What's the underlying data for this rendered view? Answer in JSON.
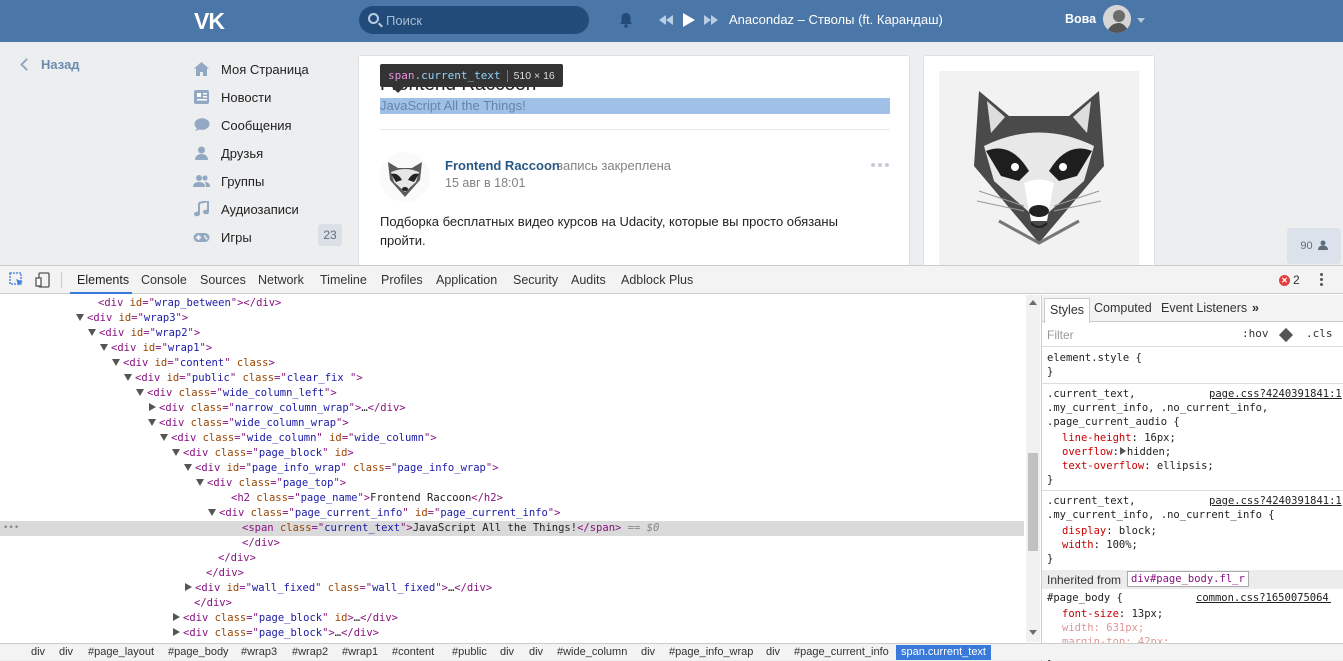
{
  "header": {
    "logo": "VK",
    "search_placeholder": "Поиск",
    "now_playing": "Anacondaz – Стволы (ft. Карандаш)",
    "user_name": "Вова"
  },
  "left_nav": {
    "back_label": "Назад",
    "items": [
      {
        "label": "Моя Страница",
        "icon": "home-icon"
      },
      {
        "label": "Новости",
        "icon": "news-icon"
      },
      {
        "label": "Сообщения",
        "icon": "messages-icon"
      },
      {
        "label": "Друзья",
        "icon": "friends-icon"
      },
      {
        "label": "Группы",
        "icon": "groups-icon"
      },
      {
        "label": "Аудиозаписи",
        "icon": "music-icon"
      },
      {
        "label": "Игры",
        "icon": "games-icon",
        "count": "23"
      }
    ]
  },
  "page": {
    "name": "Frontend Raccoon",
    "current_text": "JavaScript All the Things!",
    "tooltip": {
      "tag": "span",
      "cls": ".current_text",
      "size": "510 × 16"
    }
  },
  "post": {
    "author": "Frontend Raccoon",
    "pinned_note": "запись закреплена",
    "date": "15 авг в 18:01",
    "text": "Подборка бесплатных видео курсов на Udacity, которые вы просто обязаны пройти."
  },
  "online_count": "90",
  "devtools": {
    "tabs": [
      "Elements",
      "Console",
      "Sources",
      "Network",
      "Timeline",
      "Profiles",
      "Application",
      "Security",
      "Audits",
      "Adblock Plus"
    ],
    "active_tab": "Elements",
    "error_count": "2",
    "dom_lines": [
      [
        {
          "t": "tag",
          "v": "<div "
        },
        {
          "t": "attr",
          "v": "id"
        },
        {
          "t": "tag",
          "v": "=\""
        },
        {
          "t": "val",
          "v": "wrap_between"
        },
        {
          "t": "tag",
          "v": "\"></div>"
        }
      ],
      [
        {
          "t": "tag",
          "v": "<div "
        },
        {
          "t": "attr",
          "v": "id"
        },
        {
          "t": "tag",
          "v": "=\""
        },
        {
          "t": "val",
          "v": "wrap3"
        },
        {
          "t": "tag",
          "v": "\">"
        }
      ],
      [
        {
          "t": "tag",
          "v": "<div "
        },
        {
          "t": "attr",
          "v": "id"
        },
        {
          "t": "tag",
          "v": "=\""
        },
        {
          "t": "val",
          "v": "wrap2"
        },
        {
          "t": "tag",
          "v": "\">"
        }
      ],
      [
        {
          "t": "tag",
          "v": "<div "
        },
        {
          "t": "attr",
          "v": "id"
        },
        {
          "t": "tag",
          "v": "=\""
        },
        {
          "t": "val",
          "v": "wrap1"
        },
        {
          "t": "tag",
          "v": "\">"
        }
      ],
      [
        {
          "t": "tag",
          "v": "<div "
        },
        {
          "t": "attr",
          "v": "id"
        },
        {
          "t": "tag",
          "v": "=\""
        },
        {
          "t": "val",
          "v": "content"
        },
        {
          "t": "tag",
          "v": "\" "
        },
        {
          "t": "attr",
          "v": "class"
        },
        {
          "t": "tag",
          "v": ">"
        }
      ],
      [
        {
          "t": "tag",
          "v": "<div "
        },
        {
          "t": "attr",
          "v": "id"
        },
        {
          "t": "tag",
          "v": "=\""
        },
        {
          "t": "val",
          "v": "public"
        },
        {
          "t": "tag",
          "v": "\" "
        },
        {
          "t": "attr",
          "v": "class"
        },
        {
          "t": "tag",
          "v": "=\""
        },
        {
          "t": "val",
          "v": "clear_fix "
        },
        {
          "t": "tag",
          "v": "\">"
        }
      ],
      [
        {
          "t": "tag",
          "v": "<div "
        },
        {
          "t": "attr",
          "v": "class"
        },
        {
          "t": "tag",
          "v": "=\""
        },
        {
          "t": "val",
          "v": "wide_column_left"
        },
        {
          "t": "tag",
          "v": "\">"
        }
      ],
      [
        {
          "t": "tag",
          "v": "<div "
        },
        {
          "t": "attr",
          "v": "class"
        },
        {
          "t": "tag",
          "v": "=\""
        },
        {
          "t": "val",
          "v": "narrow_column_wrap"
        },
        {
          "t": "tag",
          "v": "\">"
        },
        {
          "t": "txt",
          "v": "…"
        },
        {
          "t": "tag",
          "v": "</div>"
        }
      ],
      [
        {
          "t": "tag",
          "v": "<div "
        },
        {
          "t": "attr",
          "v": "class"
        },
        {
          "t": "tag",
          "v": "=\""
        },
        {
          "t": "val",
          "v": "wide_column_wrap"
        },
        {
          "t": "tag",
          "v": "\">"
        }
      ],
      [
        {
          "t": "tag",
          "v": "<div "
        },
        {
          "t": "attr",
          "v": "class"
        },
        {
          "t": "tag",
          "v": "=\""
        },
        {
          "t": "val",
          "v": "wide_column"
        },
        {
          "t": "tag",
          "v": "\" "
        },
        {
          "t": "attr",
          "v": "id"
        },
        {
          "t": "tag",
          "v": "=\""
        },
        {
          "t": "val",
          "v": "wide_column"
        },
        {
          "t": "tag",
          "v": "\">"
        }
      ],
      [
        {
          "t": "tag",
          "v": "<div "
        },
        {
          "t": "attr",
          "v": "class"
        },
        {
          "t": "tag",
          "v": "=\""
        },
        {
          "t": "val",
          "v": "page_block"
        },
        {
          "t": "tag",
          "v": "\" "
        },
        {
          "t": "attr",
          "v": "id"
        },
        {
          "t": "tag",
          "v": ">"
        }
      ],
      [
        {
          "t": "tag",
          "v": "<div "
        },
        {
          "t": "attr",
          "v": "id"
        },
        {
          "t": "tag",
          "v": "=\""
        },
        {
          "t": "val",
          "v": "page_info_wrap"
        },
        {
          "t": "tag",
          "v": "\" "
        },
        {
          "t": "attr",
          "v": "class"
        },
        {
          "t": "tag",
          "v": "=\""
        },
        {
          "t": "val",
          "v": "page_info_wrap"
        },
        {
          "t": "tag",
          "v": "\">"
        }
      ],
      [
        {
          "t": "tag",
          "v": "<div "
        },
        {
          "t": "attr",
          "v": "class"
        },
        {
          "t": "tag",
          "v": "=\""
        },
        {
          "t": "val",
          "v": "page_top"
        },
        {
          "t": "tag",
          "v": "\">"
        }
      ],
      [
        {
          "t": "tag",
          "v": "<h2 "
        },
        {
          "t": "attr",
          "v": "class"
        },
        {
          "t": "tag",
          "v": "=\""
        },
        {
          "t": "val",
          "v": "page_name"
        },
        {
          "t": "tag",
          "v": "\">"
        },
        {
          "t": "txt",
          "v": "Frontend Raccoon"
        },
        {
          "t": "tag",
          "v": "</h2>"
        }
      ],
      [
        {
          "t": "tag",
          "v": "<div "
        },
        {
          "t": "attr",
          "v": "class"
        },
        {
          "t": "tag",
          "v": "=\""
        },
        {
          "t": "val",
          "v": "page_current_info"
        },
        {
          "t": "tag",
          "v": "\" "
        },
        {
          "t": "attr",
          "v": "id"
        },
        {
          "t": "tag",
          "v": "=\""
        },
        {
          "t": "val",
          "v": "page_current_info"
        },
        {
          "t": "tag",
          "v": "\">"
        }
      ],
      [
        {
          "t": "tag",
          "v": "<span "
        },
        {
          "t": "attr",
          "v": "class"
        },
        {
          "t": "tag",
          "v": "=\""
        },
        {
          "t": "val",
          "v": "current_text"
        },
        {
          "t": "tag",
          "v": "\">"
        },
        {
          "t": "txt",
          "v": "JavaScript All the Things!"
        },
        {
          "t": "tag",
          "v": "</span>"
        },
        {
          "t": "eq",
          "v": " == $0"
        }
      ],
      [
        {
          "t": "tag",
          "v": "</div>"
        }
      ],
      [
        {
          "t": "tag",
          "v": "</div>"
        }
      ],
      [
        {
          "t": "tag",
          "v": "</div>"
        }
      ],
      [
        {
          "t": "tag",
          "v": "<div "
        },
        {
          "t": "attr",
          "v": "id"
        },
        {
          "t": "tag",
          "v": "=\""
        },
        {
          "t": "val",
          "v": "wall_fixed"
        },
        {
          "t": "tag",
          "v": "\" "
        },
        {
          "t": "attr",
          "v": "class"
        },
        {
          "t": "tag",
          "v": "=\""
        },
        {
          "t": "val",
          "v": "wall_fixed"
        },
        {
          "t": "tag",
          "v": "\">"
        },
        {
          "t": "txt",
          "v": "…"
        },
        {
          "t": "tag",
          "v": "</div>"
        }
      ],
      [
        {
          "t": "tag",
          "v": "</div>"
        }
      ],
      [
        {
          "t": "tag",
          "v": "<div "
        },
        {
          "t": "attr",
          "v": "class"
        },
        {
          "t": "tag",
          "v": "=\""
        },
        {
          "t": "val",
          "v": "page_block"
        },
        {
          "t": "tag",
          "v": "\" "
        },
        {
          "t": "attr",
          "v": "id"
        },
        {
          "t": "tag",
          "v": ">"
        },
        {
          "t": "txt",
          "v": "…"
        },
        {
          "t": "tag",
          "v": "</div>"
        }
      ],
      [
        {
          "t": "tag",
          "v": "<div "
        },
        {
          "t": "attr",
          "v": "class"
        },
        {
          "t": "tag",
          "v": "=\""
        },
        {
          "t": "val",
          "v": "page_block"
        },
        {
          "t": "tag",
          "v": "\">"
        },
        {
          "t": "txt",
          "v": "…"
        },
        {
          "t": "tag",
          "v": "</div>"
        }
      ]
    ],
    "styles": {
      "tabs": [
        "Styles",
        "Computed",
        "Event Listeners"
      ],
      "more": "»",
      "filter_placeholder": "Filter",
      "hov": ":hov",
      "cls": ".cls",
      "element_style": "element.style {",
      "close_brace": "}",
      "rule1_selectors": [
        ".current_text,",
        ".my_current_info, .no_current_info,",
        ".page_current_audio {"
      ],
      "rule1_source": "page.css?4240391841:1",
      "rule1_props": [
        {
          "name": "line-height",
          "value": "16px;"
        },
        {
          "name": "overflow",
          "value": "hidden;"
        },
        {
          "name": "text-overflow",
          "value": "ellipsis;"
        }
      ],
      "rule2_selectors": [
        ".current_text,",
        ".my_current_info, .no_current_info {"
      ],
      "rule2_source": "page.css?4240391841:1",
      "rule2_props": [
        {
          "name": "display",
          "value": "block;"
        },
        {
          "name": "width",
          "value": "100%;"
        }
      ],
      "inherited_label": "Inherited from",
      "inherited_from": "div#page_body.fl_r",
      "rule3_selector": "#page_body {",
      "rule3_source": "common.css?1650075064:1",
      "rule3_props": [
        {
          "name": "font-size",
          "value": "13px;"
        },
        {
          "name": "width",
          "value": "631px;"
        },
        {
          "name": "margin-top",
          "value": "42px;"
        }
      ]
    },
    "breadcrumbs": [
      "div",
      "div",
      "#page_layout",
      "#page_body",
      "#wrap3",
      "#wrap2",
      "#wrap1",
      "#content",
      "#public",
      "div",
      "div",
      "#wide_column",
      "div",
      "#page_info_wrap",
      "div",
      "#page_current_info",
      "span.current_text"
    ]
  }
}
